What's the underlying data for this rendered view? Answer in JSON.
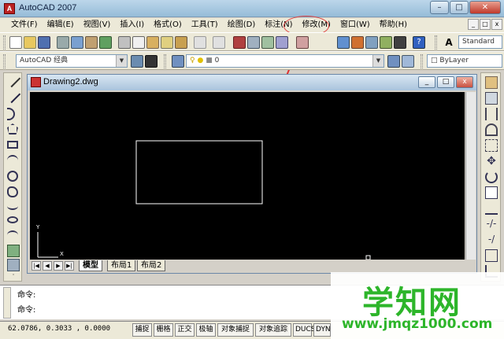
{
  "window": {
    "title": "AutoCAD 2007",
    "min": "–",
    "max": "□",
    "close": "✕"
  },
  "menubar": {
    "items": [
      "文件(F)",
      "编辑(E)",
      "视图(V)",
      "插入(I)",
      "格式(O)",
      "工具(T)",
      "绘图(D)",
      "标注(N)",
      "修改(M)",
      "窗口(W)",
      "帮助(H)"
    ]
  },
  "toolbar": {
    "workspace": "AutoCAD 经典",
    "style": "Standard",
    "layer": "0",
    "linetype": "ByLayer"
  },
  "drawing": {
    "title": "Drawing2.dwg",
    "y_axis": "Y",
    "x_axis": "X"
  },
  "tabs": [
    "模型",
    "布局1",
    "布局2"
  ],
  "command": {
    "line1": "命令:",
    "line2": "命令:"
  },
  "status": {
    "coords": "62.0786, 0.3033 , 0.0000",
    "buttons": [
      "捕捉",
      "栅格",
      "正交",
      "极轴",
      "对象捕捉",
      "对象追踪",
      "DUCS",
      "DYN"
    ]
  },
  "watermark": {
    "text": "学知网",
    "url": "www.jmqz1000.com"
  },
  "colors": {
    "highlight": "#e04040",
    "watermark": "#2db52a",
    "canvas": "#000000"
  }
}
